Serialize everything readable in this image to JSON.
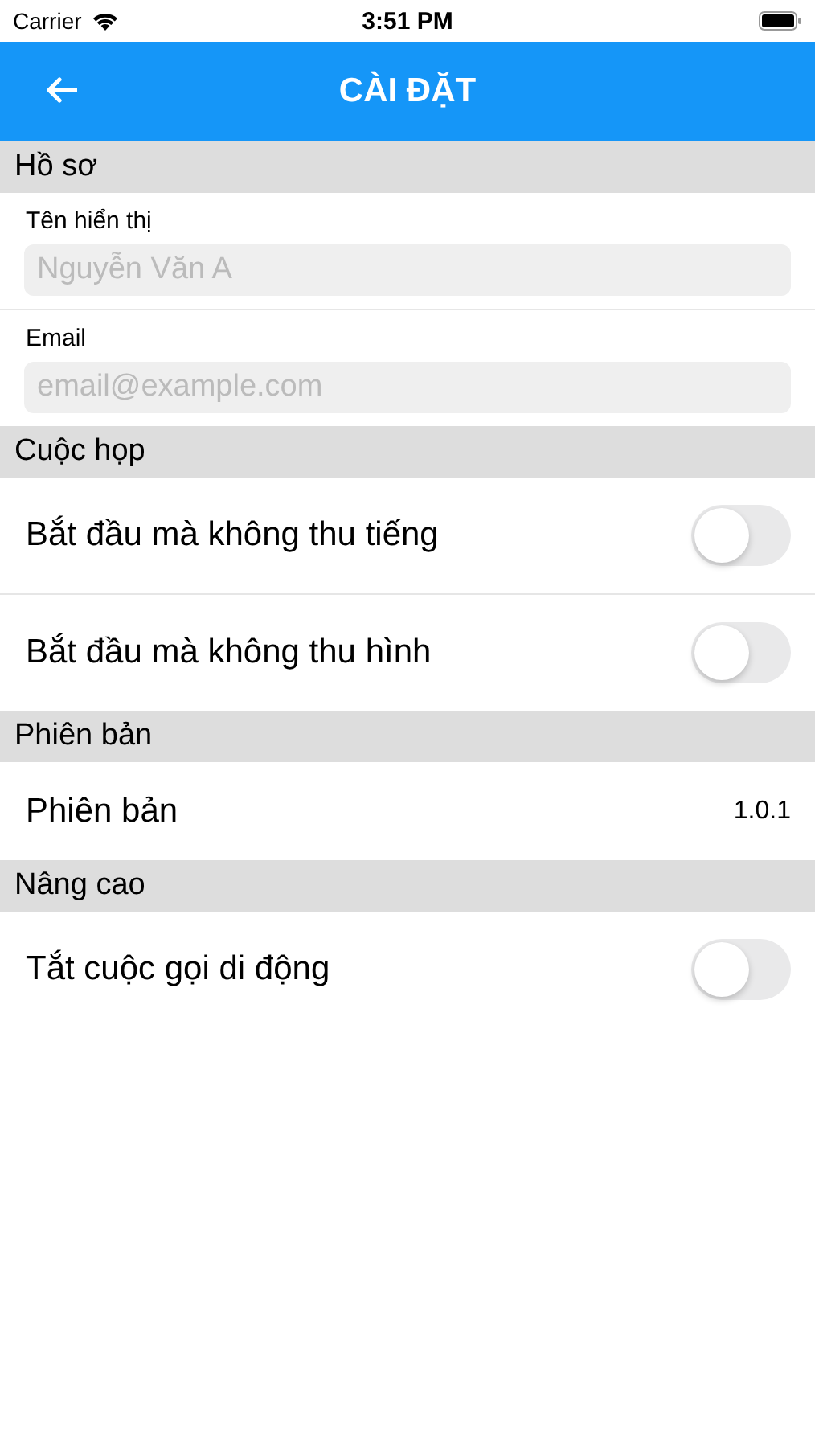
{
  "status_bar": {
    "carrier": "Carrier",
    "time": "3:51 PM"
  },
  "nav_bar": {
    "title": "CÀI ĐẶT"
  },
  "sections": [
    {
      "title": "Hồ sơ",
      "rows": [
        {
          "kind": "field",
          "label": "Tên hiển thị",
          "placeholder": "Nguyễn Văn A"
        },
        {
          "kind": "field",
          "label": "Email",
          "placeholder": "email@example.com"
        }
      ]
    },
    {
      "title": "Cuộc họp",
      "rows": [
        {
          "kind": "toggle",
          "label": "Bắt đầu mà không thu tiếng",
          "on": false
        },
        {
          "kind": "toggle",
          "label": "Bắt đầu mà không thu hình",
          "on": false
        }
      ]
    },
    {
      "title": "Phiên bản",
      "rows": [
        {
          "kind": "value",
          "label": "Phiên bản",
          "value": "1.0.1"
        }
      ]
    },
    {
      "title": "Nâng cao",
      "rows": [
        {
          "kind": "toggle",
          "label": "Tắt cuộc gọi di động",
          "on": false
        }
      ]
    }
  ]
}
